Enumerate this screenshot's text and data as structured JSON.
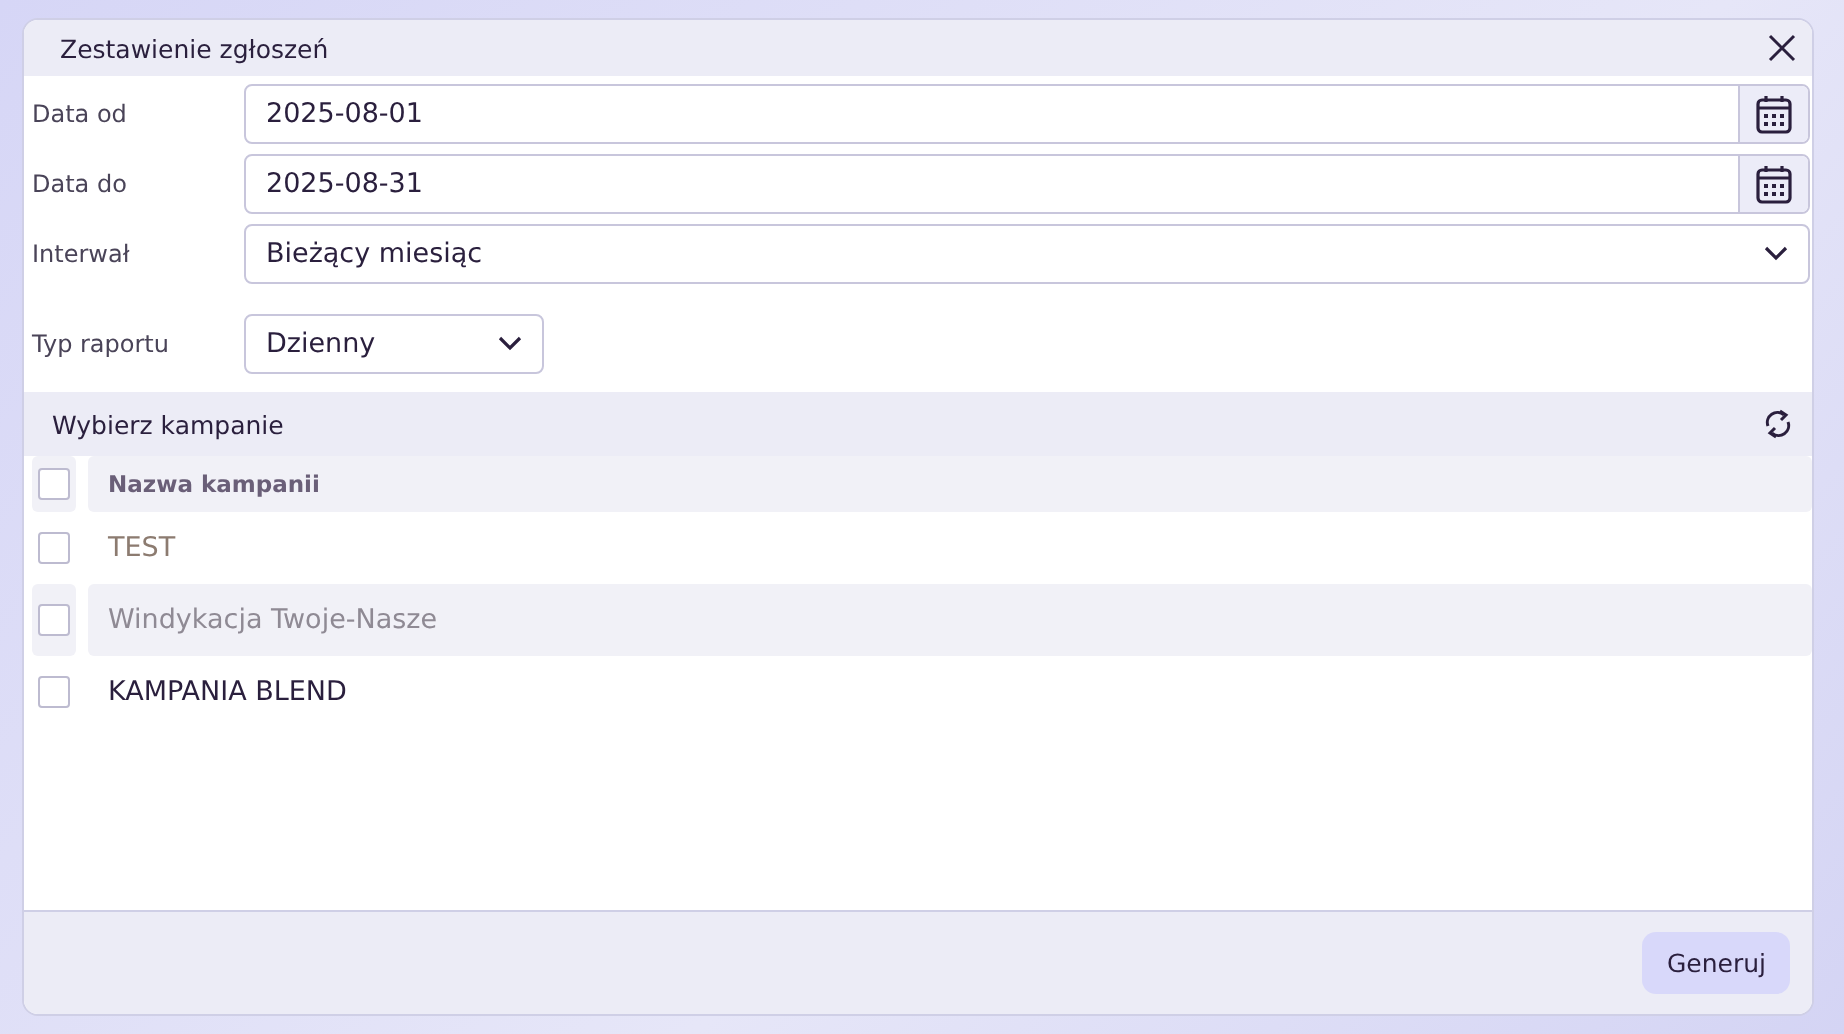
{
  "dialog": {
    "title": "Zestawienie zgłoszeń"
  },
  "fields": [
    {
      "label": "Data od",
      "kind": "date",
      "value": "2025-08-01"
    },
    {
      "label": "Data do",
      "kind": "date",
      "value": "2025-08-31"
    },
    {
      "label": "Interwał",
      "kind": "select",
      "value": "Bieżący miesiąc"
    }
  ],
  "report_type": {
    "label": "Typ raportu",
    "value": "Dzienny"
  },
  "campaigns": {
    "title": "Wybierz kampanie",
    "column": "Nazwa kampanii",
    "header_checked": false,
    "rows": [
      {
        "name": "TEST",
        "checked": false,
        "color": "#8c7b70"
      },
      {
        "name": "Windykacja Twoje-Nasze",
        "checked": false,
        "color": "#8f8a94"
      },
      {
        "name": "KAMPANIA BLEND",
        "checked": false,
        "color": "#2a1f3d"
      }
    ]
  },
  "buttons": [
    {
      "label": "Generuj"
    }
  ]
}
